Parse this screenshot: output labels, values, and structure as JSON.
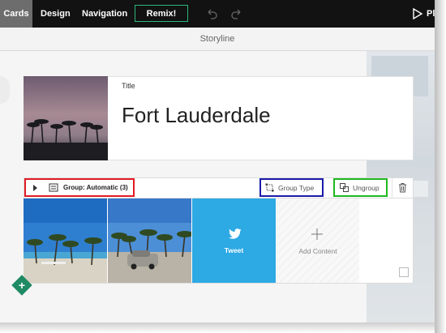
{
  "toolbar": {
    "tabs": [
      "Cards",
      "Design",
      "Navigation"
    ],
    "remix_label": "Remix!",
    "play_label": "Pla",
    "accent_color": "#2fb67a"
  },
  "storyline": {
    "title": "Storyline"
  },
  "title_card": {
    "label": "Title",
    "text": "Fort Lauderdale"
  },
  "group": {
    "label": "Group: Automatic (3)",
    "group_type_label": "Group Type",
    "ungroup_label": "Ungroup",
    "tweet_label": "Tweet",
    "add_content_label": "Add Content"
  },
  "icons": {
    "undo": "undo-icon",
    "redo": "redo-icon",
    "play": "play-icon",
    "trash": "trash-icon",
    "twitter": "twitter-bird-icon",
    "plus": "plus-icon"
  },
  "annotation_colors": {
    "red": "#e01b24",
    "blue": "#1a1aa8",
    "green": "#1fb81f"
  }
}
